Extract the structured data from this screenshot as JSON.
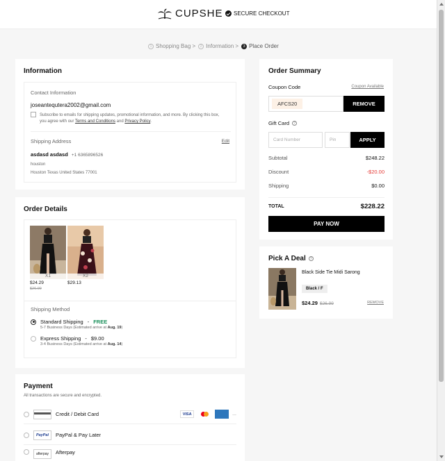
{
  "header": {
    "brand": "CUPSHE",
    "secure_label": "SECURE CHECKOUT"
  },
  "breadcrumb": [
    {
      "num": "1",
      "label": "Shopping Bag >"
    },
    {
      "num": "2",
      "label": "Information >"
    },
    {
      "num": "3",
      "label": "Place Order"
    }
  ],
  "information": {
    "title": "Information",
    "contact_label": "Contact Information",
    "email": "joseantequtera2002@gmail.com",
    "subscribe_line1": "Subscribe to emails for shipping updates, promotional information, and more. By clicking this box,",
    "subscribe_prefix": "you agree with our",
    "terms_label": "Terms and Conditions",
    "and": "and",
    "privacy_label": "Privacy Policy",
    "shipping_label": "Shipping Address",
    "edit_label": "Edit",
    "name": "asdasd asdasd",
    "phone": "+1 6365896526",
    "address1": "houston",
    "address2": "Houston Texas United States 77001"
  },
  "order_details": {
    "title": "Order Details",
    "items": [
      {
        "qty": "X1",
        "price": "$24.29",
        "original": "$26.99"
      },
      {
        "qty": "X2",
        "price": "$29.13",
        "original": ""
      }
    ],
    "shipping_method_label": "Shipping Method",
    "options": [
      {
        "name": "Standard Shipping",
        "price": "FREE",
        "eta": "5-7 Business Days (Estimated arrive at",
        "date": "Aug. 19",
        "selected": true
      },
      {
        "name": "Express Shipping",
        "price": "$9.00",
        "eta": "3-4 Business Days (Estimated arrive at",
        "date": "Aug. 14",
        "selected": false
      }
    ]
  },
  "payment": {
    "title": "Payment",
    "subtitle": "All transactions are secure and encrypted.",
    "methods": [
      {
        "label": "Credit / Debit Card",
        "logo": "card-icon"
      },
      {
        "label": "PayPal & Pay Later",
        "logo_text": "PayPal"
      },
      {
        "label": "Afterpay",
        "logo_text": "afterpay"
      }
    ],
    "card_brands": [
      "VISA",
      "mastercard",
      "AMEX",
      "..."
    ]
  },
  "summary": {
    "title": "Order Summary",
    "coupon_label": "Coupon Code",
    "coupon_available": "Coupon Available",
    "coupon_value": "AFCS20",
    "remove_label": "REMOVE",
    "gift_label": "Gift Card",
    "card_number_placeholder": "Card Number",
    "pin_placeholder": "Pin",
    "apply_label": "APPLY",
    "rows": [
      {
        "label": "Subtotal",
        "value": "$248.22"
      },
      {
        "label": "Discount",
        "value": "-$20.00"
      },
      {
        "label": "Shipping",
        "value": "$0.00"
      }
    ],
    "total_label": "TOTAL",
    "total_value": "$228.22",
    "pay_now": "PAY NOW"
  },
  "deal": {
    "title": "Pick A Deal",
    "product": "Black Side Tie Midi Sarong",
    "variant": "Black / F",
    "price": "$24.29",
    "original": "$26.99",
    "remove": "REMOVE"
  },
  "colors": {
    "accent_green": "#1a8f5a",
    "discount_red": "#e53935"
  }
}
